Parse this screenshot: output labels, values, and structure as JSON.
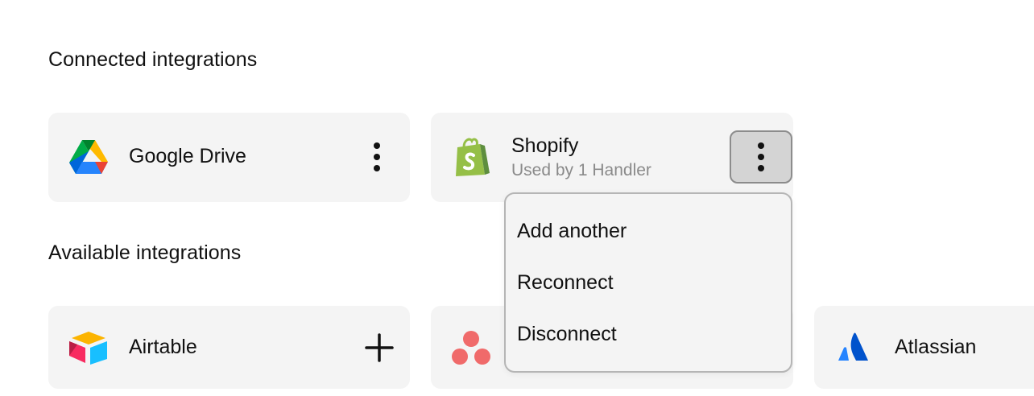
{
  "sections": {
    "connected_title": "Connected integrations",
    "available_title": "Available integrations"
  },
  "connected": [
    {
      "name": "Google Drive",
      "icon": "google-drive-icon"
    },
    {
      "name": "Shopify",
      "subtitle": "Used by 1 Handler",
      "icon": "shopify-icon"
    }
  ],
  "available": [
    {
      "name": "Airtable",
      "icon": "airtable-icon"
    },
    {
      "name": "",
      "icon": "asana-icon"
    },
    {
      "name": "Atlassian",
      "icon": "atlassian-icon"
    }
  ],
  "menu": {
    "items": [
      "Add another",
      "Reconnect",
      "Disconnect"
    ]
  },
  "icons": {
    "more": "more-vertical-icon",
    "add": "plus-icon"
  },
  "colors": {
    "card_bg": "#f4f4f4",
    "menu_border": "#b5b5b5",
    "active_button_bg": "#d4d4d4",
    "subtitle": "#8a8a8a",
    "shopify_green": "#95bf47",
    "asana_coral": "#f06a6a",
    "atlassian_blue": "#2684ff"
  }
}
